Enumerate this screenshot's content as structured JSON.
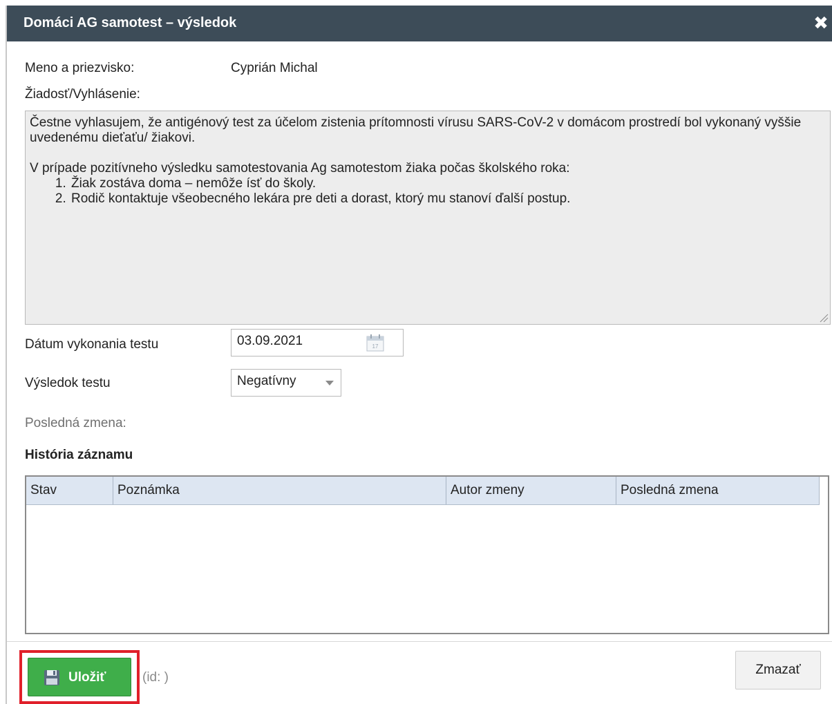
{
  "dialog": {
    "title": "Domáci AG samotest – výsledok",
    "close_glyph": "✖"
  },
  "form": {
    "name_label": "Meno a priezvisko:",
    "name_value": "Cyprián Michal",
    "request_label": "Žiadosť/Vyhlásenie:",
    "declaration": {
      "paragraph1": "Čestne vyhlasujem, že antigénový test za účelom zistenia prítomnosti vírusu SARS-CoV-2 v domácom prostredí bol vykonaný vyššie uvedenému dieťaťu/ žiakovi.",
      "paragraph2": "V prípade pozitívneho výsledku samotestovania Ag samotestom žiaka počas školského roka:",
      "steps": [
        "Žiak zostáva doma – nemôže ísť do školy.",
        "Rodič kontaktuje všeobecného lekára pre deti a dorast, ktorý mu stanoví ďalší postup."
      ]
    },
    "date_label": "Dátum vykonania testu",
    "date_value": "03.09.2021",
    "result_label": "Výsledok testu",
    "result_value": "Negatívny",
    "last_change_label": "Posledná zmena:"
  },
  "history": {
    "title": "História záznamu",
    "columns": [
      "Stav",
      "Poznámka",
      "Autor zmeny",
      "Posledná zmena"
    ],
    "rows": []
  },
  "footer": {
    "save_label": "Uložiť",
    "id_label": "(id: )",
    "delete_label": "Zmazať"
  },
  "colors": {
    "titlebar": "#3d4c58",
    "save_button": "#3fae4a",
    "highlight": "#e0202a",
    "grid_header": "#dde6f2"
  },
  "icons": {
    "close": "close-icon",
    "calendar": "calendar-icon",
    "save": "floppy-disk-icon",
    "dropdown": "chevron-down-icon",
    "resize": "resize-grip-icon"
  }
}
